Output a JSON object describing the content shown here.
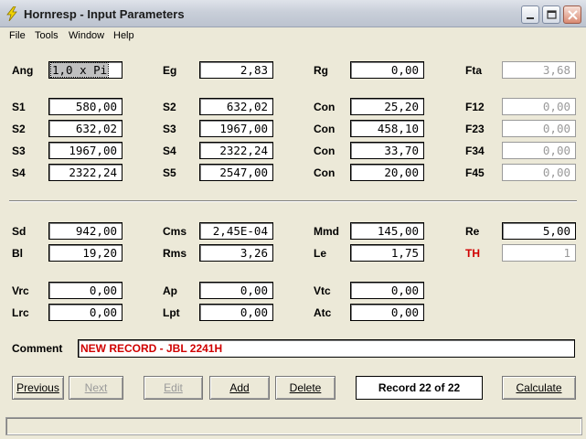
{
  "window": {
    "title": "Hornresp - Input Parameters",
    "icon": "lightning-bolt-icon"
  },
  "menu": [
    "File",
    "Tools",
    "Window",
    "Help"
  ],
  "labels": {
    "ang": "Ang",
    "eg": "Eg",
    "rg": "Rg",
    "fta": "Fta",
    "s1": "S1",
    "s2": "S2",
    "s3": "S3",
    "s4": "S4",
    "s5": "S5",
    "con": "Con",
    "f12": "F12",
    "f23": "F23",
    "f34": "F34",
    "f45": "F45",
    "sd": "Sd",
    "cms": "Cms",
    "mmd": "Mmd",
    "re": "Re",
    "bl": "Bl",
    "rms": "Rms",
    "le": "Le",
    "th": "TH",
    "vrc": "Vrc",
    "ap": "Ap",
    "vtc": "Vtc",
    "lrc": "Lrc",
    "lpt": "Lpt",
    "atc": "Atc",
    "comment": "Comment"
  },
  "values": {
    "ang": "1,0 x Pi",
    "eg": "2,83",
    "rg": "0,00",
    "fta": "3,68",
    "row1": {
      "s1": "580,00",
      "s2": "632,02",
      "con": "25,20",
      "f12": "0,00"
    },
    "row2": {
      "s2": "632,02",
      "s3": "1967,00",
      "con": "458,10",
      "f23": "0,00"
    },
    "row3": {
      "s3": "1967,00",
      "s4": "2322,24",
      "con": "33,70",
      "f34": "0,00"
    },
    "row4": {
      "s4": "2322,24",
      "s5": "2547,00",
      "con": "20,00",
      "f45": "0,00"
    },
    "sd": "942,00",
    "cms": "2,45E-04",
    "mmd": "145,00",
    "re": "5,00",
    "bl": "19,20",
    "rms": "3,26",
    "le": "1,75",
    "th": "1",
    "vrc": "0,00",
    "ap": "0,00",
    "vtc": "0,00",
    "lrc": "0,00",
    "lpt": "0,00",
    "atc": "0,00"
  },
  "comment": "NEW RECORD - JBL 2241H",
  "buttons": {
    "previous": "Previous",
    "next": "Next",
    "edit": "Edit",
    "add": "Add",
    "delete": "Delete",
    "calculate": "Calculate"
  },
  "record_status": "Record 22 of 22",
  "colors": {
    "accent_red": "#d00000",
    "window_bg": "#ECE9D8"
  }
}
